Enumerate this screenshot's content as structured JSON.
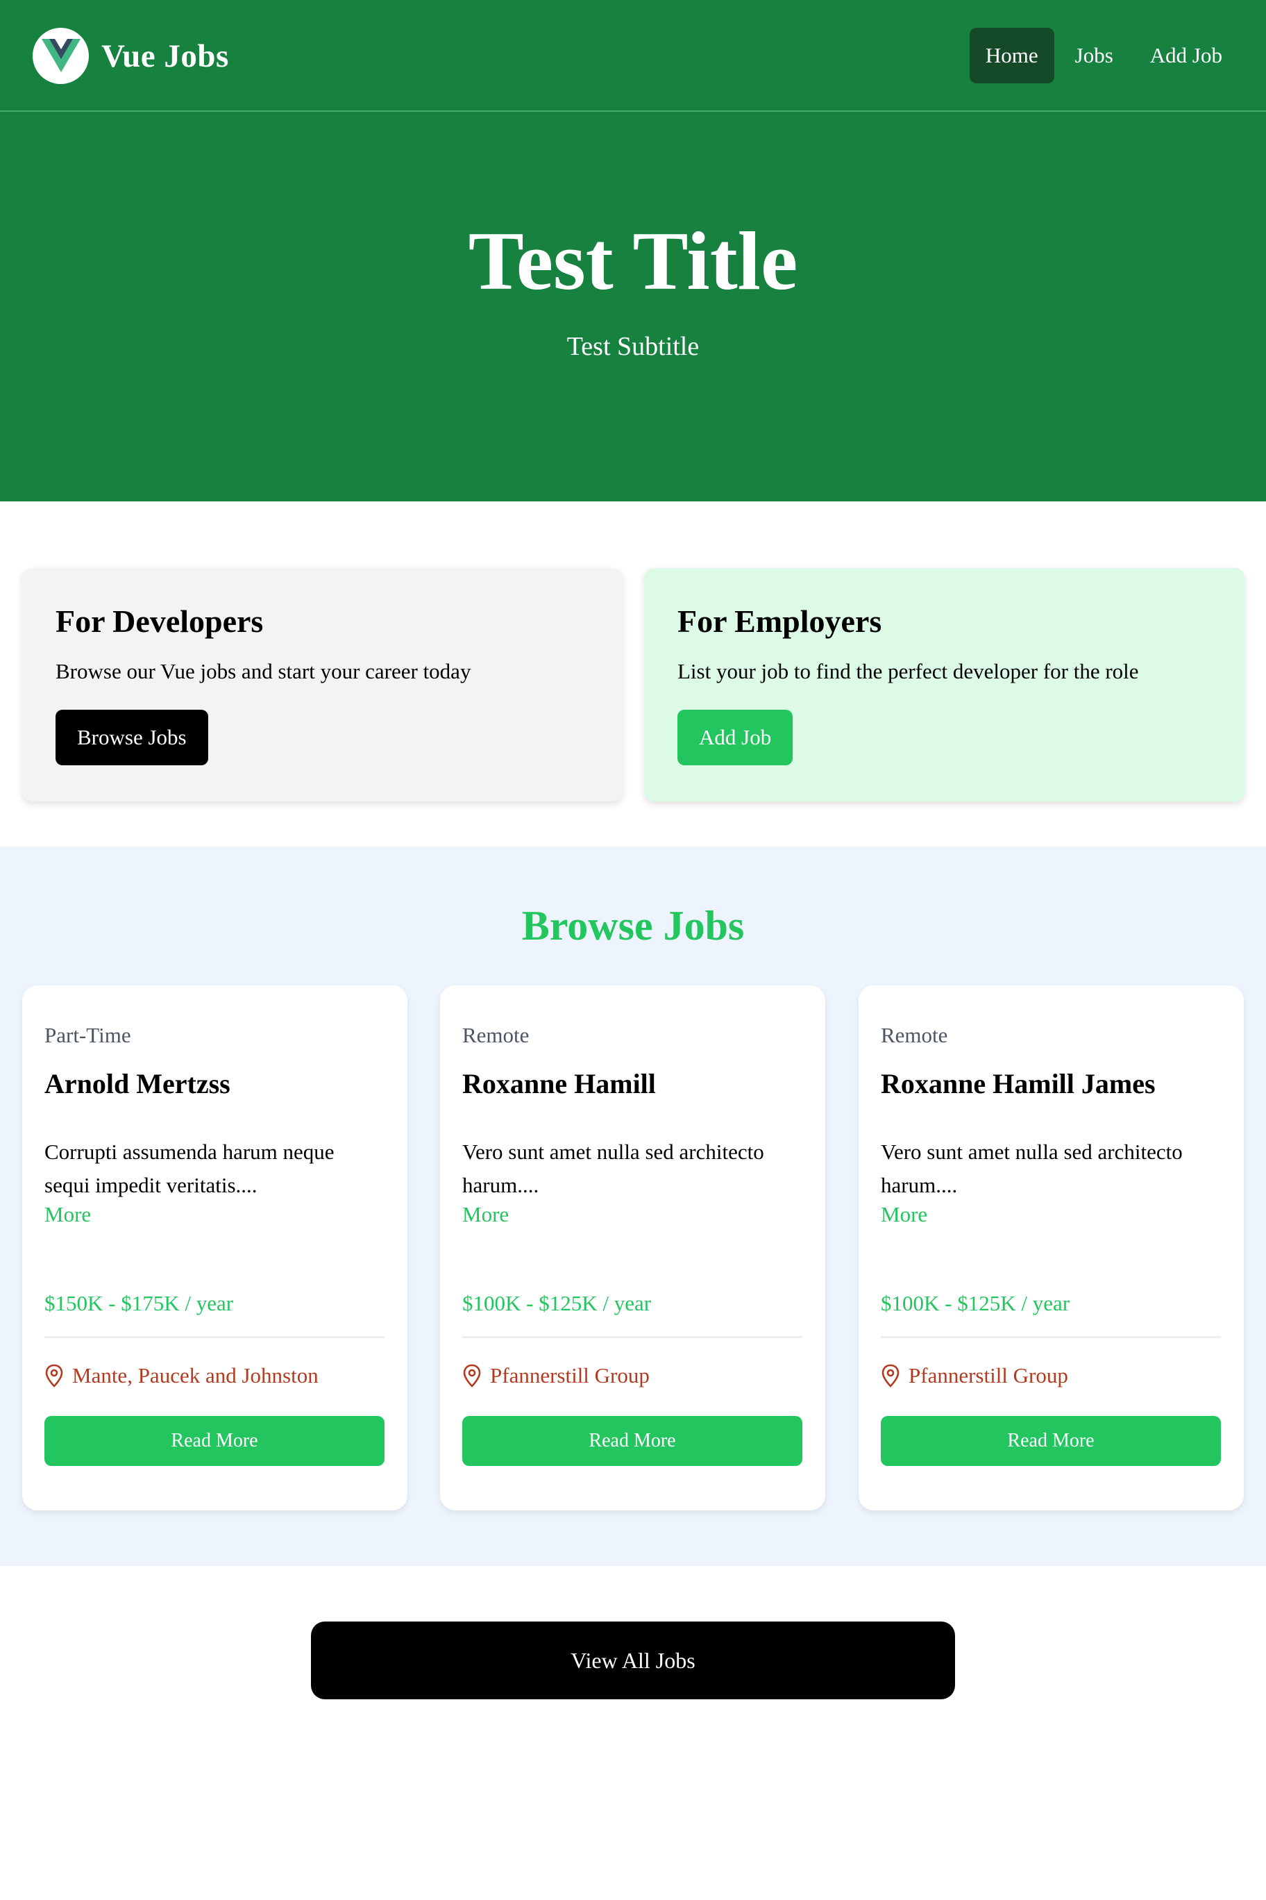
{
  "navbar": {
    "brand": "Vue Jobs",
    "links": [
      {
        "label": "Home"
      },
      {
        "label": "Jobs"
      },
      {
        "label": "Add Job"
      }
    ]
  },
  "hero": {
    "title": "Test Title",
    "subtitle": "Test Subtitle"
  },
  "cards": {
    "developers": {
      "title": "For Developers",
      "text": "Browse our Vue jobs and start your career today",
      "button": "Browse Jobs"
    },
    "employers": {
      "title": "For Employers",
      "text": "List your job to find the perfect developer for the role",
      "button": "Add Job"
    }
  },
  "browse": {
    "title": "Browse Jobs",
    "jobs": [
      {
        "type": "Part-Time",
        "title": "Arnold Mertzss",
        "description": "Corrupti assumenda harum neque sequi impedit veritatis....",
        "more": "More",
        "salary": "$150K - $175K / year",
        "location": "Mante, Paucek and Johnston",
        "button": "Read More"
      },
      {
        "type": "Remote",
        "title": "Roxanne Hamill",
        "description": "Vero sunt amet nulla sed architecto harum....",
        "more": "More",
        "salary": "$100K - $125K / year",
        "location": "Pfannerstill Group",
        "button": "Read More"
      },
      {
        "type": "Remote",
        "title": "Roxanne Hamill James",
        "description": "Vero sunt amet nulla sed architecto harum....",
        "more": "More",
        "salary": "$100K - $125K / year",
        "location": "Pfannerstill Group",
        "button": "Read More"
      }
    ]
  },
  "view_all": {
    "label": "View All Jobs"
  },
  "colors": {
    "header_green": "#178140",
    "active_nav": "#144a27",
    "accent_green": "#22c55e",
    "location_red": "#b43a1f",
    "browse_bg": "#eef4fd"
  },
  "icons": {
    "logo": "vue-logo-icon",
    "location": "map-pin-icon"
  }
}
